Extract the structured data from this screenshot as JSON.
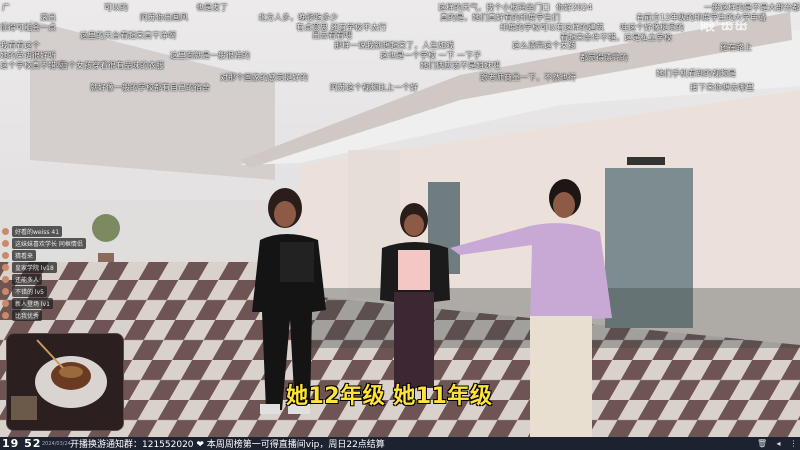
{
  "subtitle": "她12年级 她11年级",
  "watermark": "眼 ꕥꕥ",
  "bottom_bar": {
    "time": "19 52",
    "date": "2024/03/24",
    "ticker": "开播换游通知群：121552020 ❤ 本周周榜第一可得直播间vip，周日22点结算"
  },
  "chat": [
    {
      "text": "好看的weiss 41"
    },
    {
      "text": "这妹妹喜欢学长 同框情侣"
    },
    {
      "text": "猜看来"
    },
    {
      "text": "皇家学院 lv18"
    },
    {
      "text": "还能多人"
    },
    {
      "text": "不错的 lv5"
    },
    {
      "text": "新人登场 lv1"
    },
    {
      "text": "比我优秀"
    }
  ],
  "danmaku": [
    {
      "text": "广"
    },
    {
      "text": "滚出"
    },
    {
      "text": "阿苏你出画风"
    },
    {
      "text": "北方人多，晚餐吃多少"
    },
    {
      "text": "这样的天气，找个小板凳坐门口"
    },
    {
      "text": "你好2024"
    },
    {
      "text": "一般这样的是不是大部分都 几点"
    },
    {
      "text": "这里的天台看起来真干净啊"
    },
    {
      "text": "出去看看吧"
    },
    {
      "text": "可以的"
    },
    {
      "text": "也是发了"
    },
    {
      "text": "右前方12年级的印度学生的大学申请"
    },
    {
      "text": "真的是，她们真好看的印度学生们"
    },
    {
      "text": "那样一说我就想起来了，人生如戏"
    },
    {
      "text": "印度的学校可以有这样的建筑"
    },
    {
      "text": "看起来条件不错，这是私立学校"
    },
    {
      "text": "这也是一个学校 一下 一下子"
    },
    {
      "text": "她的英语很好听"
    },
    {
      "text": "两个女孩穿着很有品味的衣服"
    },
    {
      "text": "她们手机看到的视频是"
    },
    {
      "text": "这个学校真不错啊"
    },
    {
      "text": "这里面就是一般很难的"
    },
    {
      "text": "我看看这个"
    },
    {
      "text": "这么漂亮这个女孩"
    },
    {
      "text": "她们俩应该不是姐妹吧"
    },
    {
      "text": "有点意思 还有学校不太行"
    },
    {
      "text": "哇这个好像挺贵的"
    },
    {
      "text": "对那个国家的感觉挺好的"
    },
    {
      "text": "懂得可能会一点"
    },
    {
      "text": "跟老师商量一下，不然也行"
    },
    {
      "text": "就好像一般的学校都有自己的宿舍"
    },
    {
      "text": "阿苏这个视频比上一个好"
    },
    {
      "text": "都觉得漂亮的"
    },
    {
      "text": "还在路上"
    },
    {
      "text": "接下来你想去哪里"
    }
  ]
}
